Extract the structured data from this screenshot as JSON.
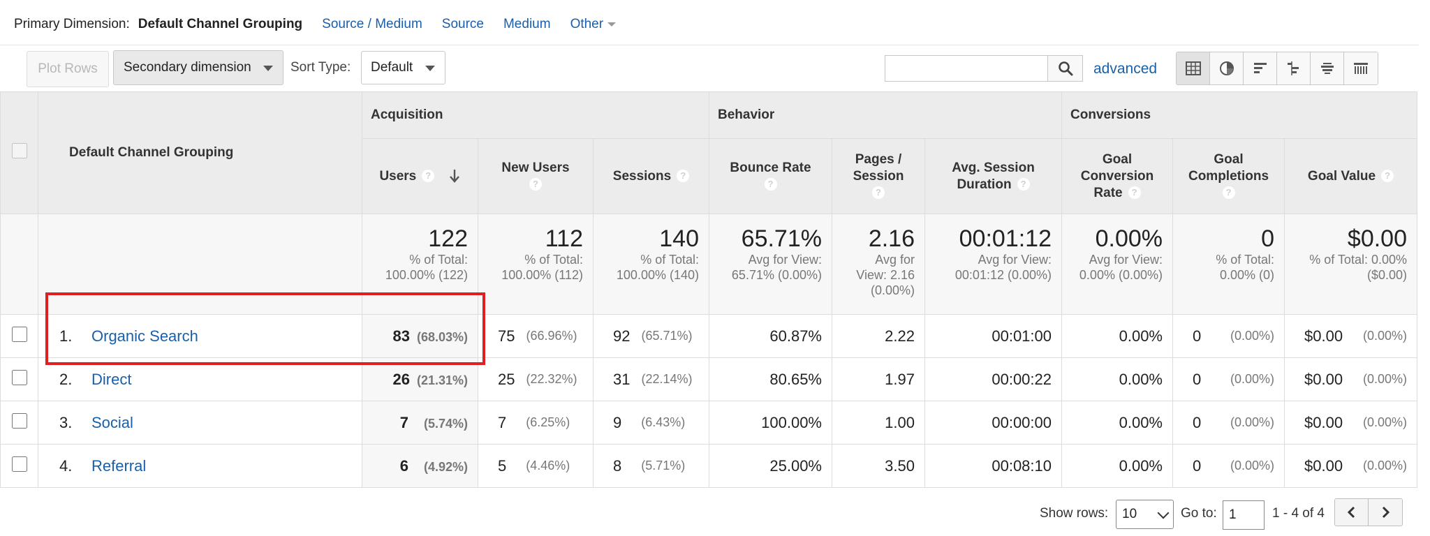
{
  "primary_dimension": {
    "label": "Primary Dimension:",
    "current": "Default Channel Grouping",
    "links": [
      "Source / Medium",
      "Source",
      "Medium"
    ],
    "other": "Other"
  },
  "toolbar": {
    "plot_rows": "Plot Rows",
    "secondary_dimension": "Secondary dimension",
    "sort_type_label": "Sort Type:",
    "sort_type_value": "Default",
    "search_placeholder": "",
    "advanced": "advanced",
    "view_icons": [
      "table-view-icon",
      "pie-view-icon",
      "performance-view-icon",
      "comparison-view-icon",
      "term-cloud-view-icon",
      "pivot-view-icon"
    ]
  },
  "table": {
    "dimension_header": "Default Channel Grouping",
    "groups": [
      "Acquisition",
      "Behavior",
      "Conversions"
    ],
    "columns": [
      "Users",
      "New Users",
      "Sessions",
      "Bounce Rate",
      "Pages / Session",
      "Avg. Session Duration",
      "Goal Conversion Rate",
      "Goal Completions",
      "Goal Value"
    ],
    "column_lines": {
      "pages_session": [
        "Pages /",
        "Session"
      ],
      "avg_session": [
        "Avg. Session",
        "Duration"
      ],
      "goal_conv": [
        "Goal",
        "Conversion",
        "Rate"
      ],
      "goal_comp": [
        "Goal",
        "Completions"
      ]
    },
    "totals": {
      "users": {
        "value": "122",
        "sub1": "% of Total:",
        "sub2": "100.00% (122)"
      },
      "new_users": {
        "value": "112",
        "sub1": "% of Total:",
        "sub2": "100.00% (112)"
      },
      "sessions": {
        "value": "140",
        "sub1": "% of Total:",
        "sub2": "100.00% (140)"
      },
      "bounce": {
        "value": "65.71%",
        "sub1": "Avg for View:",
        "sub2": "65.71% (0.00%)"
      },
      "pages": {
        "value": "2.16",
        "sub1": "Avg for",
        "sub2": "View: 2.16",
        "sub3": "(0.00%)"
      },
      "duration": {
        "value": "00:01:12",
        "sub1": "Avg for View:",
        "sub2": "00:01:12 (0.00%)"
      },
      "conv_rate": {
        "value": "0.00%",
        "sub1": "Avg for View:",
        "sub2": "0.00% (0.00%)"
      },
      "completions": {
        "value": "0",
        "sub1": "% of Total:",
        "sub2": "0.00% (0)"
      },
      "goal_value": {
        "value": "$0.00",
        "sub1": "% of Total: 0.00%",
        "sub2": "($0.00)"
      }
    },
    "rows": [
      {
        "idx": "1.",
        "name": "Organic Search",
        "users": "83",
        "users_pct": "(68.03%)",
        "new_users": "75",
        "new_users_pct": "(66.96%)",
        "sessions": "92",
        "sessions_pct": "(65.71%)",
        "bounce": "60.87%",
        "pages": "2.22",
        "duration": "00:01:00",
        "conv_rate": "0.00%",
        "completions": "0",
        "completions_pct": "(0.00%)",
        "goal_value": "$0.00",
        "goal_value_pct": "(0.00%)"
      },
      {
        "idx": "2.",
        "name": "Direct",
        "users": "26",
        "users_pct": "(21.31%)",
        "new_users": "25",
        "new_users_pct": "(22.32%)",
        "sessions": "31",
        "sessions_pct": "(22.14%)",
        "bounce": "80.65%",
        "pages": "1.97",
        "duration": "00:00:22",
        "conv_rate": "0.00%",
        "completions": "0",
        "completions_pct": "(0.00%)",
        "goal_value": "$0.00",
        "goal_value_pct": "(0.00%)"
      },
      {
        "idx": "3.",
        "name": "Social",
        "users": "7",
        "users_pct": "(5.74%)",
        "new_users": "7",
        "new_users_pct": "(6.25%)",
        "sessions": "9",
        "sessions_pct": "(6.43%)",
        "bounce": "100.00%",
        "pages": "1.00",
        "duration": "00:00:00",
        "conv_rate": "0.00%",
        "completions": "0",
        "completions_pct": "(0.00%)",
        "goal_value": "$0.00",
        "goal_value_pct": "(0.00%)"
      },
      {
        "idx": "4.",
        "name": "Referral",
        "users": "6",
        "users_pct": "(4.92%)",
        "new_users": "5",
        "new_users_pct": "(4.46%)",
        "sessions": "8",
        "sessions_pct": "(5.71%)",
        "bounce": "25.00%",
        "pages": "3.50",
        "duration": "00:08:10",
        "conv_rate": "0.00%",
        "completions": "0",
        "completions_pct": "(0.00%)",
        "goal_value": "$0.00",
        "goal_value_pct": "(0.00%)"
      }
    ]
  },
  "footer": {
    "show_rows_label": "Show rows:",
    "show_rows_value": "10",
    "goto_label": "Go to:",
    "goto_value": "1",
    "range": "1 - 4 of 4"
  },
  "colors": {
    "link": "#1a5fa8",
    "highlight": "#e02020"
  }
}
